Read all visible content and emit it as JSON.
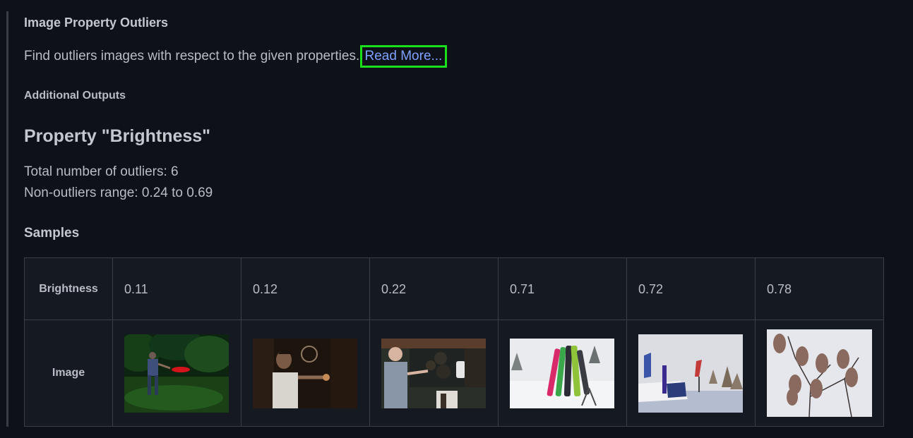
{
  "check": {
    "title": "Image Property Outliers",
    "description": "Find outliers images with respect to the given properties.",
    "read_more": "Read More..."
  },
  "additional_outputs_label": "Additional Outputs",
  "property": {
    "title": "Property \"Brightness\"",
    "total_outliers_text": "Total number of outliers: 6",
    "range_text": "Non-outliers range: 0.24 to 0.69"
  },
  "samples": {
    "title": "Samples",
    "row_labels": {
      "brightness": "Brightness",
      "image": "Image"
    },
    "items": [
      {
        "brightness": "0.11",
        "scene": "man throwing frisbee at night in green field"
      },
      {
        "brightness": "0.12",
        "scene": "man in white shirt in dark room"
      },
      {
        "brightness": "0.22",
        "scene": "man in kitchen with pans"
      },
      {
        "brightness": "0.71",
        "scene": "snowboards standing in snow"
      },
      {
        "brightness": "0.72",
        "scene": "snowboard park with banner"
      },
      {
        "brightness": "0.78",
        "scene": "birds perched on branches"
      }
    ]
  },
  "colors": {
    "accent_link": "#7da1ff",
    "highlight_box": "#19e01b",
    "background": "#0e1117"
  }
}
